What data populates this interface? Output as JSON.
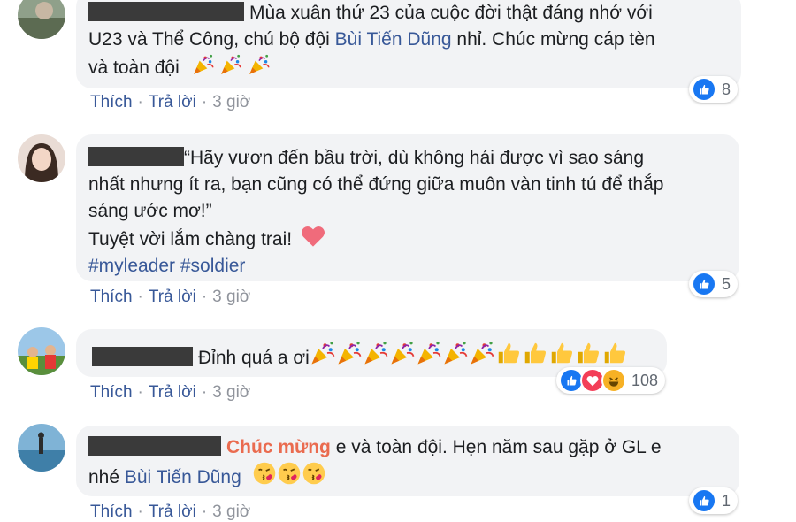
{
  "comments": [
    {
      "text": "Mùa xuân thứ 23 của cuộc đời thật đáng nhớ với",
      "text2": "U23 và Thể Công, chú bộ đội ",
      "mention": "Bùi Tiến Dũng",
      "text3": " nhỉ. Chúc mừng cáp tèn",
      "text4": "và toàn đội",
      "reaction_count": "8",
      "actions": {
        "like": "Thích",
        "reply": "Trả lời",
        "time": "3 giờ"
      }
    },
    {
      "text": "“Hãy vươn đến bầu trời, dù không hái được vì sao sáng",
      "text2": "nhất nhưng ít ra, bạn cũng có thể đứng giữa muôn vàn tinh tú để thắp",
      "text3": "sáng ước mơ!”",
      "text4": "Tuyệt vời lắm chàng trai!",
      "tags": "#myleader #soldier",
      "reaction_count": "5",
      "actions": {
        "like": "Thích",
        "reply": "Trả lời",
        "time": "3 giờ"
      }
    },
    {
      "text": "Đỉnh quá a ơi",
      "reaction_count": "108",
      "actions": {
        "like": "Thích",
        "reply": "Trả lời",
        "time": "3 giờ"
      }
    },
    {
      "highlight": "Chúc mừng",
      "text": " e và toàn đội. Hẹn năm sau gặp ở GL e",
      "text2": "nhé ",
      "mention": "Bùi Tiến Dũng",
      "reaction_count": "1",
      "actions": {
        "like": "Thích",
        "reply": "Trả lời",
        "time": "3 giờ"
      }
    }
  ],
  "colors": {
    "link": "#385898",
    "bubble": "#f2f3f5",
    "like": "#1877f2",
    "love": "#f33e58",
    "haha": "#f7b125"
  },
  "icons": [
    "party-popper-icon",
    "thumbs-up-icon",
    "heart-icon",
    "kiss-icon",
    "like-reaction-icon",
    "love-reaction-icon",
    "haha-reaction-icon"
  ]
}
